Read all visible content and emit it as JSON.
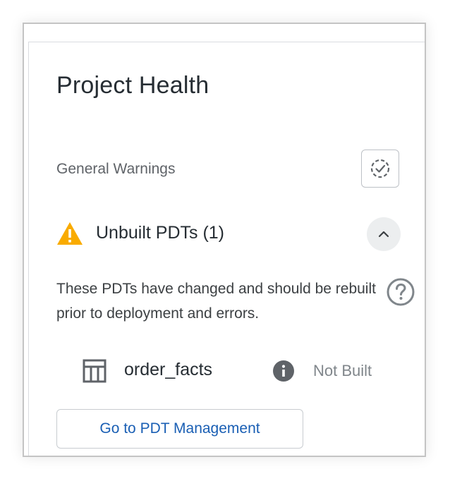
{
  "panel": {
    "title": "Project Health"
  },
  "general_warnings": {
    "label": "General Warnings",
    "status_icon": "dashed-circle-check-icon"
  },
  "unbuilt_section": {
    "icon": "warning-triangle-icon",
    "icon_color": "#f9ab00",
    "label": "Unbuilt PDTs (1)",
    "toggle_icon": "chevron-up-icon",
    "description": "These PDTs have changed and should be rebuilt prior to deployment and errors.",
    "help_icon": "help-circle-icon",
    "items": [
      {
        "icon": "table-icon",
        "name": "order_facts",
        "info_icon": "info-icon",
        "status": "Not Built"
      }
    ]
  },
  "actions": {
    "goto_label": "Go to PDT Management",
    "accent": "#1a5fb4"
  }
}
